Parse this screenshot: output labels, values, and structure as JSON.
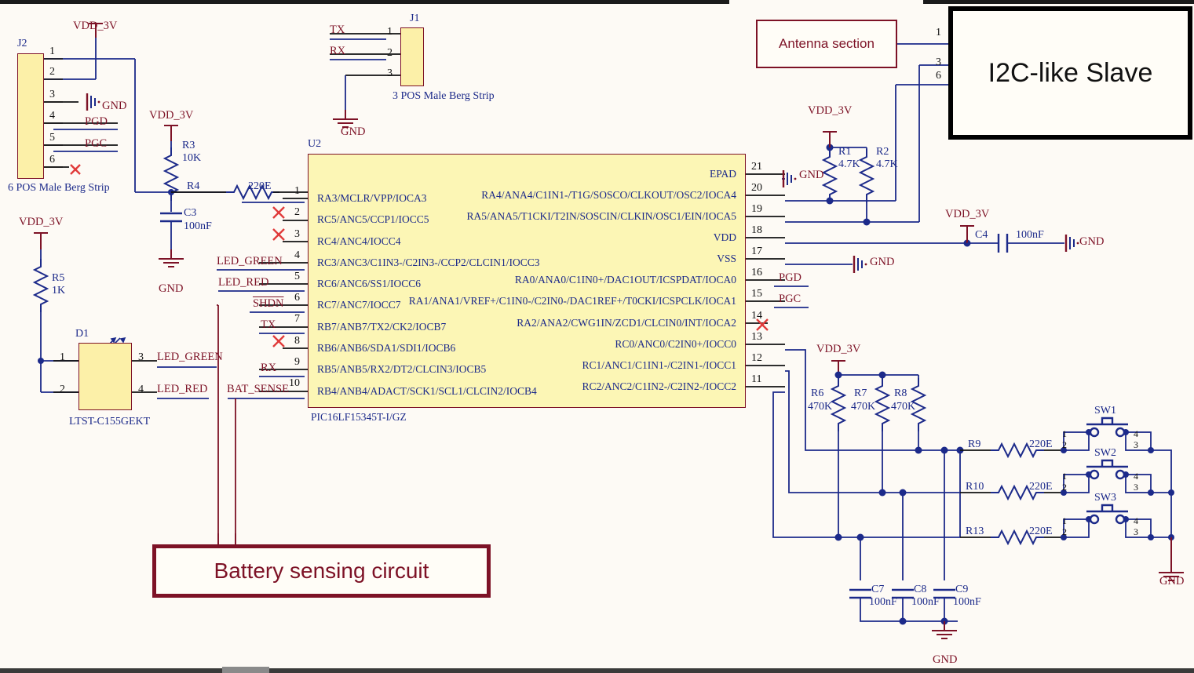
{
  "diagram": {
    "title_part": "PIC16LF15345T-I/GZ",
    "mcu_ref": "U2"
  },
  "callouts": {
    "antenna": "Antenna section",
    "battery": "Battery sensing circuit",
    "i2c": "I2C-like Slave"
  },
  "nets": {
    "vdd": "VDD_3V",
    "gnd": "GND",
    "pgd": "PGD",
    "pgc": "PGC",
    "tx": "TX",
    "rx": "RX",
    "shdn": "SHDN",
    "bat_sense": "BAT_SENSE",
    "led_green": "LED_GREEN",
    "led_red": "LED_RED"
  },
  "connectors": {
    "j2": {
      "ref": "J2",
      "desc": "6 POS Male Berg Strip",
      "pins": [
        "1",
        "2",
        "3",
        "4",
        "5",
        "6"
      ],
      "pin_nets": [
        "",
        "",
        "GND",
        "PGD",
        "PGC",
        ""
      ]
    },
    "j1": {
      "ref": "J1",
      "desc": "3 POS Male Berg Strip",
      "pins": [
        "1",
        "2",
        "3"
      ],
      "pin_nets": [
        "TX",
        "RX",
        ""
      ]
    },
    "d1": {
      "ref": "D1",
      "desc": "LTST-C155GEKT",
      "pins": [
        "1",
        "2",
        "3",
        "4"
      ],
      "pin_nets": [
        "",
        "",
        "LED_GREEN",
        "LED_RED"
      ]
    }
  },
  "mcu": {
    "ref": "U2",
    "part": "PIC16LF15345T-I/GZ",
    "left_pins": [
      {
        "num": "1",
        "name": "RA3/MCLR/VPP/IOCA3",
        "net": "",
        "nc": false
      },
      {
        "num": "2",
        "name": "RC5/ANC5/CCP1/IOCC5",
        "net": "",
        "nc": true
      },
      {
        "num": "3",
        "name": "RC4/ANC4/IOCC4",
        "net": "",
        "nc": true
      },
      {
        "num": "4",
        "name": "RC3/ANC3/C1IN3-/C2IN3-/CCP2/CLCIN1/IOCC3",
        "net": "LED_GREEN",
        "nc": false
      },
      {
        "num": "5",
        "name": "RC6/ANC6/SS1/IOCC6",
        "net": "LED_RED",
        "nc": false
      },
      {
        "num": "6",
        "name": "RC7/ANC7/IOCC7",
        "net": "SHDN",
        "nc": false
      },
      {
        "num": "7",
        "name": "RB7/ANB7/TX2/CK2/IOCB7",
        "net": "TX",
        "nc": false
      },
      {
        "num": "8",
        "name": "RB6/ANB6/SDA1/SDI1/IOCB6",
        "net": "",
        "nc": true
      },
      {
        "num": "9",
        "name": "RB5/ANB5/RX2/DT2/CLCIN3/IOCB5",
        "net": "RX",
        "nc": false
      },
      {
        "num": "10",
        "name": "RB4/ANB4/ADACT/SCK1/SCL1/CLCIN2/IOCB4",
        "net": "BAT_SENSE",
        "nc": false
      }
    ],
    "right_pins": [
      {
        "num": "21",
        "name": "EPAD",
        "net": "GND",
        "nc": false
      },
      {
        "num": "20",
        "name": "RA4/ANA4/C1IN1-/T1G/SOSCO/CLKOUT/OSC2/IOCA4",
        "net": "",
        "nc": false
      },
      {
        "num": "19",
        "name": "RA5/ANA5/T1CKI/T2IN/SOSCIN/CLKIN/OSC1/EIN/IOCA5",
        "net": "",
        "nc": false
      },
      {
        "num": "18",
        "name": "VDD",
        "net": "",
        "nc": false
      },
      {
        "num": "17",
        "name": "VSS",
        "net": "GND",
        "nc": false
      },
      {
        "num": "16",
        "name": "RA0/ANA0/C1IN0+/DAC1OUT/ICSPDAT/IOCA0",
        "net": "PGD",
        "nc": false
      },
      {
        "num": "15",
        "name": "RA1/ANA1/VREF+/C1IN0-/C2IN0-/DAC1REF+/T0CKI/ICSPCLK/IOCA1",
        "net": "PGC",
        "nc": false
      },
      {
        "num": "14",
        "name": "RA2/ANA2/CWG1IN/ZCD1/CLCIN0/INT/IOCA2",
        "net": "",
        "nc": true
      },
      {
        "num": "13",
        "name": "RC0/ANC0/C2IN0+/IOCC0",
        "net": "",
        "nc": false
      },
      {
        "num": "12",
        "name": "RC1/ANC1/C1IN1-/C2IN1-/IOCC1",
        "net": "",
        "nc": false
      },
      {
        "num": "11",
        "name": "RC2/ANC2/C1IN2-/C2IN2-/IOCC2",
        "net": "",
        "nc": false
      }
    ]
  },
  "components": {
    "r1": {
      "ref": "R1",
      "value": "4.7K"
    },
    "r2": {
      "ref": "R2",
      "value": "4.7K"
    },
    "r3": {
      "ref": "R3",
      "value": "10K"
    },
    "r4": {
      "ref": "R4",
      "value": "220E"
    },
    "r5": {
      "ref": "R5",
      "value": "1K"
    },
    "r6": {
      "ref": "R6",
      "value": "470K"
    },
    "r7": {
      "ref": "R7",
      "value": "470K"
    },
    "r8": {
      "ref": "R8",
      "value": "470K"
    },
    "r9": {
      "ref": "R9",
      "value": "220E"
    },
    "r10": {
      "ref": "R10",
      "value": "220E"
    },
    "r13": {
      "ref": "R13",
      "value": "220E"
    },
    "c3": {
      "ref": "C3",
      "value": "100nF"
    },
    "c4": {
      "ref": "C4",
      "value": "100nF"
    },
    "c7": {
      "ref": "C7",
      "value": "100nF"
    },
    "c8": {
      "ref": "C8",
      "value": "100nF"
    },
    "c9": {
      "ref": "C9",
      "value": "100nF"
    }
  },
  "switches": [
    {
      "ref": "SW1",
      "pins": [
        "1",
        "2",
        "4",
        "3"
      ]
    },
    {
      "ref": "SW2",
      "pins": [
        "1",
        "2",
        "4",
        "3"
      ]
    },
    {
      "ref": "SW3",
      "pins": [
        "1",
        "2",
        "4",
        "3"
      ]
    }
  ],
  "i2c_slave_pins": [
    "1",
    "3",
    "6"
  ],
  "colors": {
    "wire_blue": "#1c2a8a",
    "wire_dark": "#7d1226",
    "chip_fill": "#fcf6b5",
    "background": "#fdfaf5"
  }
}
